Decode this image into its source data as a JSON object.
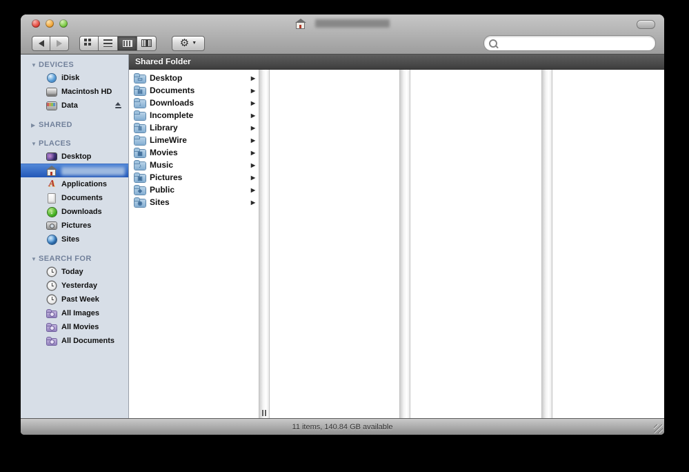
{
  "window": {
    "title": {
      "redacted": true
    },
    "status_text": "11 items, 140.84 GB available"
  },
  "search": {
    "placeholder": ""
  },
  "icons": {
    "triangle_down": "▼",
    "triangle_right": "▶",
    "row_arrow": "▶",
    "gear": "⚙",
    "gear_menu_arrow": "▼"
  },
  "sidebar": {
    "sections": [
      {
        "label": "DEVICES",
        "expanded": true,
        "items": [
          {
            "label": "iDisk",
            "icon": "idisk-icon"
          },
          {
            "label": "Macintosh HD",
            "icon": "macintosh-hd-icon"
          },
          {
            "label": "Data",
            "icon": "data-disk-icon",
            "eject": true
          }
        ]
      },
      {
        "label": "SHARED",
        "expanded": false,
        "items": []
      },
      {
        "label": "PLACES",
        "expanded": true,
        "items": [
          {
            "label": "Desktop",
            "icon": "desktop-icon"
          },
          {
            "label": "",
            "name": "home",
            "icon": "home-icon",
            "selected": true,
            "redacted": true
          },
          {
            "label": "Applications",
            "icon": "applications-icon"
          },
          {
            "label": "Documents",
            "icon": "documents-icon"
          },
          {
            "label": "Downloads",
            "icon": "downloads-icon"
          },
          {
            "label": "Pictures",
            "icon": "pictures-icon"
          },
          {
            "label": "Sites",
            "icon": "sites-icon"
          }
        ]
      },
      {
        "label": "SEARCH FOR",
        "expanded": true,
        "items": [
          {
            "label": "Today",
            "icon": "clock-icon"
          },
          {
            "label": "Yesterday",
            "icon": "clock-icon"
          },
          {
            "label": "Past Week",
            "icon": "clock-icon"
          },
          {
            "label": "All Images",
            "icon": "smart-folder-icon"
          },
          {
            "label": "All Movies",
            "icon": "smart-folder-icon"
          },
          {
            "label": "All Documents",
            "icon": "smart-folder-icon"
          }
        ]
      }
    ]
  },
  "column_view": {
    "header": "Shared Folder",
    "folders": [
      {
        "label": "Desktop",
        "glyph": "▭"
      },
      {
        "label": "Documents",
        "glyph": "▤"
      },
      {
        "label": "Downloads",
        "glyph": "↓"
      },
      {
        "label": "Incomplete",
        "glyph": ""
      },
      {
        "label": "Library",
        "glyph": "Ⅲ"
      },
      {
        "label": "LimeWire",
        "glyph": ""
      },
      {
        "label": "Movies",
        "glyph": "▦"
      },
      {
        "label": "Music",
        "glyph": "♪"
      },
      {
        "label": "Pictures",
        "glyph": "▣"
      },
      {
        "label": "Public",
        "glyph": "◈"
      },
      {
        "label": "Sites",
        "glyph": "◉"
      }
    ]
  },
  "colors": {
    "selection_top": "#5288d8",
    "selection_bottom": "#2257b8",
    "sidebar_bg": "#d7dee7",
    "column_header_bg": "#4a4a4a"
  }
}
